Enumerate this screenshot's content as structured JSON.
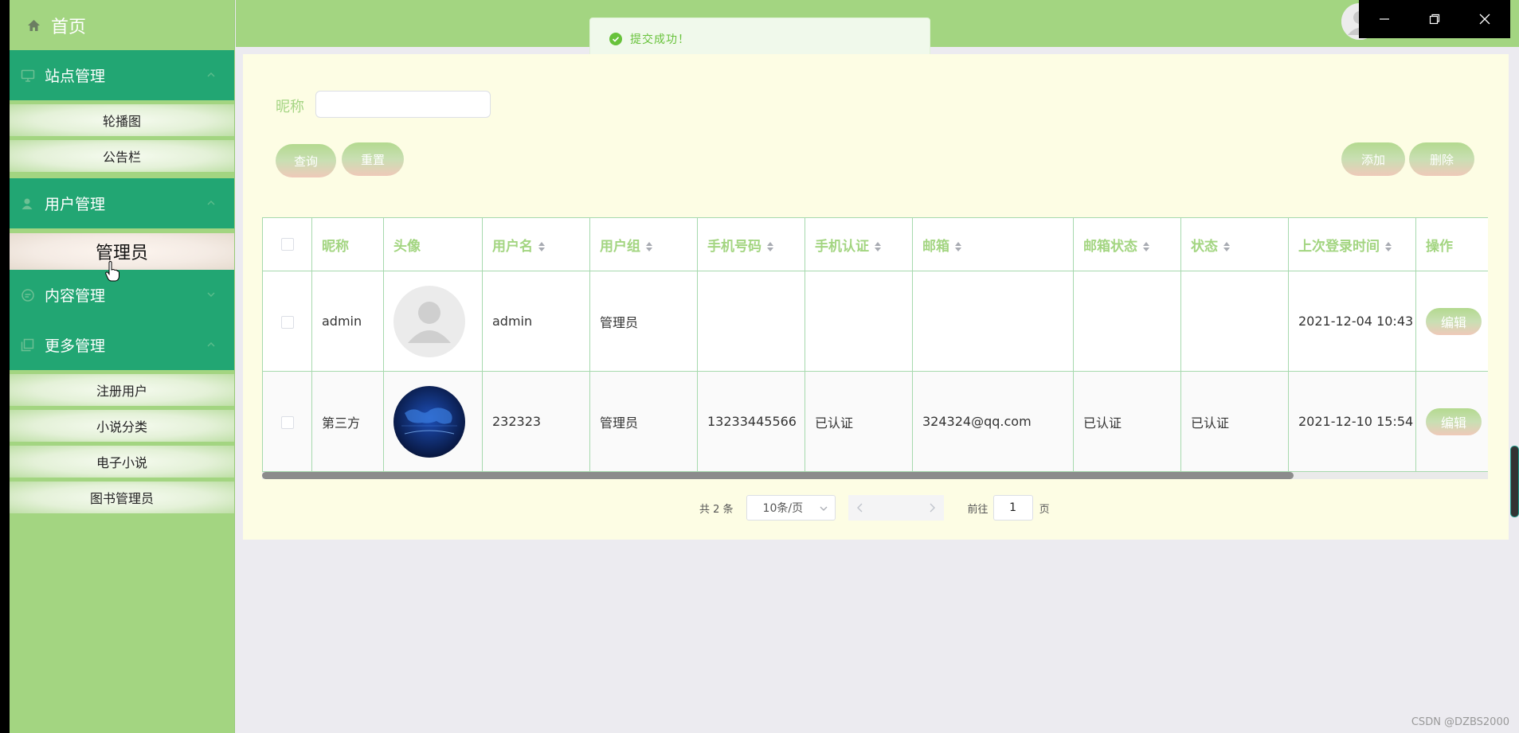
{
  "sidebar": {
    "home": "首页",
    "groups": [
      {
        "label": "站点管理",
        "items": [
          "轮播图",
          "公告栏"
        ]
      },
      {
        "label": "用户管理",
        "items": [
          "管理员"
        ]
      },
      {
        "label": "内容管理",
        "items": []
      },
      {
        "label": "更多管理",
        "items": [
          "注册用户",
          "小说分类",
          "电子小说",
          "图书管理员"
        ]
      }
    ]
  },
  "toast": {
    "message": "提交成功！"
  },
  "search": {
    "label": "昵称",
    "value": ""
  },
  "buttons": {
    "query": "查询",
    "reset": "重置",
    "add": "添加",
    "delete": "删除"
  },
  "table": {
    "headers": [
      "昵称",
      "头像",
      "用户名",
      "用户组",
      "手机号码",
      "手机认证",
      "邮箱",
      "邮箱状态",
      "状态",
      "上次登录时间",
      "操作"
    ],
    "rows": [
      {
        "nickname": "admin",
        "username": "admin",
        "group": "管理员",
        "phone": "",
        "phone_auth": "",
        "email": "",
        "email_status": "",
        "status": "",
        "last_login": "2021-12-04 10:43",
        "action": "编辑"
      },
      {
        "nickname": "第三方",
        "username": "232323",
        "group": "管理员",
        "phone": "13233445566",
        "phone_auth": "已认证",
        "email": "324324@qq.com",
        "email_status": "已认证",
        "status": "已认证",
        "last_login": "2021-12-10 15:54",
        "action": "编辑"
      }
    ]
  },
  "pagination": {
    "total": "共 2 条",
    "page_size": "10条/页",
    "goto": "前往",
    "page": "1",
    "unit": "页"
  },
  "watermark": "CSDN @DZBS2000",
  "colors": {
    "sidebar_bg": "#a3d581",
    "group_bg": "#22a673",
    "panel_bg": "#fdfde4",
    "header_text": "#a3d581",
    "success": "#67c23a"
  }
}
